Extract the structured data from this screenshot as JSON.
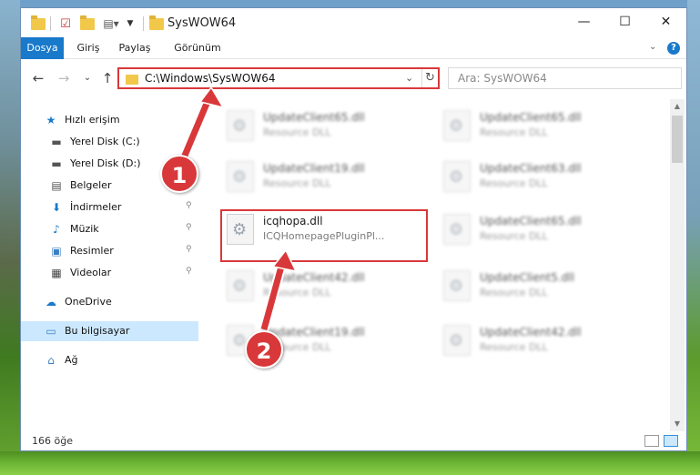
{
  "window": {
    "title": "SysWOW64",
    "controls": {
      "minimize": "—",
      "maximize": "☐",
      "close": "✕"
    }
  },
  "ribbon": {
    "tabs": [
      "Dosya",
      "Giriş",
      "Paylaş",
      "Görünüm"
    ],
    "help": "?",
    "collapse": "⌄"
  },
  "nav": {
    "back": "←",
    "forward": "→",
    "recent": "⌄",
    "up": "↑",
    "address": "C:\\Windows\\SysWOW64",
    "address_dropdown": "⌄",
    "refresh": "↻",
    "search_placeholder": "Ara: SysWOW64"
  },
  "sidebar": {
    "items": [
      {
        "label": "Hızlı erişim",
        "icon": "★",
        "color": "#1979ca",
        "pinned": false
      },
      {
        "label": "Yerel Disk (C:)",
        "icon": "▬",
        "color": "#555555",
        "pinned": true
      },
      {
        "label": "Yerel Disk (D:)",
        "icon": "▬",
        "color": "#555555",
        "pinned": true
      },
      {
        "label": "Belgeler",
        "icon": "▤",
        "color": "#555555",
        "pinned": true
      },
      {
        "label": "İndirmeler",
        "icon": "⬇",
        "color": "#1979ca",
        "pinned": true
      },
      {
        "label": "Müzik",
        "icon": "♪",
        "color": "#1979ca",
        "pinned": true
      },
      {
        "label": "Resimler",
        "icon": "▣",
        "color": "#3a7fc2",
        "pinned": true
      },
      {
        "label": "Videolar",
        "icon": "▦",
        "color": "#444444",
        "pinned": true
      },
      {
        "label": "OneDrive",
        "icon": "☁",
        "color": "#1979ca",
        "pinned": false
      },
      {
        "label": "Bu bilgisayar",
        "icon": "▭",
        "color": "#3a7fc2",
        "pinned": false
      },
      {
        "label": "Ağ",
        "icon": "⌂",
        "color": "#3a7fc2",
        "pinned": false
      }
    ],
    "pin_glyph": "📌"
  },
  "files": {
    "left": [
      {
        "name": "UpdateClient65.dll",
        "type": "Resource DLL"
      },
      {
        "name": "UpdateClient19.dll",
        "type": "Resource DLL"
      },
      {
        "name": "icqhopa.dll",
        "type": "ICQHomepagePluginPl..."
      },
      {
        "name": "UpdateClient42.dll",
        "type": "Resource DLL"
      },
      {
        "name": "UpdateClient19.dll",
        "type": "Resource DLL"
      }
    ],
    "right": [
      {
        "name": "UpdateClient65.dll",
        "type": "Resource DLL"
      },
      {
        "name": "UpdateClient63.dll",
        "type": "Resource DLL"
      },
      {
        "name": "UpdateClient65.dll",
        "type": "Resource DLL"
      },
      {
        "name": "UpdateClient5.dll",
        "type": "Resource DLL"
      },
      {
        "name": "UpdateClient42.dll",
        "type": "Resource DLL"
      }
    ]
  },
  "status": {
    "count": "166 öğe"
  },
  "scroll": {
    "up": "▲",
    "down": "▼"
  },
  "callouts": {
    "one": "1",
    "two": "2"
  },
  "colors": {
    "accent": "#1979ca",
    "highlight": "#d9383a",
    "selected": "#cce8ff"
  }
}
